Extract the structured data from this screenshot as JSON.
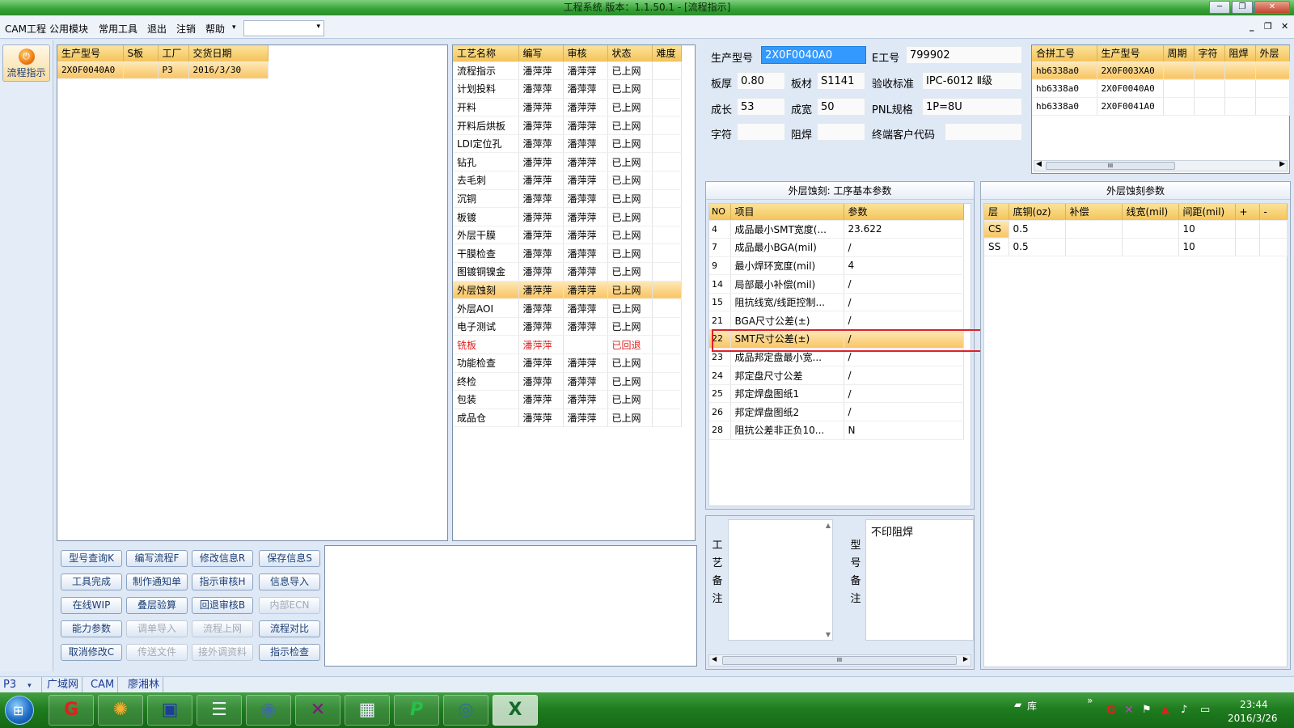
{
  "window": {
    "title": "工程系统   版本：1.1.50.1 - [流程指示]"
  },
  "menu": [
    "CAM工程",
    "公用模块",
    "常用工具",
    "退出",
    "注销",
    "帮助"
  ],
  "menu_dropdown_arrow": "▾",
  "toolbar": {
    "flow_button": "流程指示"
  },
  "orders": {
    "headers": [
      "生产型号",
      "S板",
      "工厂",
      "交货日期"
    ],
    "rows": [
      [
        "2X0F0040A0",
        "",
        "P3",
        "2016/3/30"
      ]
    ]
  },
  "process": {
    "headers": [
      "工艺名称",
      "编写",
      "审核",
      "状态",
      "难度"
    ],
    "rows": [
      [
        "流程指示",
        "潘萍萍",
        "潘萍萍",
        "已上网",
        ""
      ],
      [
        "计划投料",
        "潘萍萍",
        "潘萍萍",
        "已上网",
        ""
      ],
      [
        "开料",
        "潘萍萍",
        "潘萍萍",
        "已上网",
        ""
      ],
      [
        "开料后烘板",
        "潘萍萍",
        "潘萍萍",
        "已上网",
        ""
      ],
      [
        "LDI定位孔",
        "潘萍萍",
        "潘萍萍",
        "已上网",
        ""
      ],
      [
        "钻孔",
        "潘萍萍",
        "潘萍萍",
        "已上网",
        ""
      ],
      [
        "去毛刺",
        "潘萍萍",
        "潘萍萍",
        "已上网",
        ""
      ],
      [
        "沉铜",
        "潘萍萍",
        "潘萍萍",
        "已上网",
        ""
      ],
      [
        "板镀",
        "潘萍萍",
        "潘萍萍",
        "已上网",
        ""
      ],
      [
        "外层干膜",
        "潘萍萍",
        "潘萍萍",
        "已上网",
        ""
      ],
      [
        "干膜检查",
        "潘萍萍",
        "潘萍萍",
        "已上网",
        ""
      ],
      [
        "图镀铜镍金",
        "潘萍萍",
        "潘萍萍",
        "已上网",
        ""
      ],
      [
        "外层蚀刻",
        "潘萍萍",
        "潘萍萍",
        "已上网",
        ""
      ],
      [
        "外层AOI",
        "潘萍萍",
        "潘萍萍",
        "已上网",
        ""
      ],
      [
        "电子测试",
        "潘萍萍",
        "潘萍萍",
        "已上网",
        ""
      ],
      [
        "铣板",
        "潘萍萍",
        "",
        "已回退",
        ""
      ],
      [
        "功能检查",
        "潘萍萍",
        "潘萍萍",
        "已上网",
        ""
      ],
      [
        "终检",
        "潘萍萍",
        "潘萍萍",
        "已上网",
        ""
      ],
      [
        "包装",
        "潘萍萍",
        "潘萍萍",
        "已上网",
        ""
      ],
      [
        "成品仓",
        "潘萍萍",
        "潘萍萍",
        "已上网",
        ""
      ]
    ],
    "selected_index": 12,
    "rejected_index": 15
  },
  "info": {
    "model_label": "生产型号",
    "model": "2X0F0040A0",
    "eno_label": "E工号",
    "eno": "799902",
    "thick_label": "板厚",
    "thick": "0.80",
    "mat_label": "板材",
    "mat": "S1141",
    "std_label": "验收标准",
    "std": "IPC-6012 Ⅱ级",
    "len_label": "成长",
    "len": "53",
    "wid_label": "成宽",
    "wid": "50",
    "pnl_label": "PNL规格",
    "pnl": "1P=8U",
    "char_label": "字符",
    "mask_label": "阻焊",
    "cust_label": "终端客户代码"
  },
  "combine": {
    "headers": [
      "合拼工号",
      "生产型号",
      "周期",
      "字符",
      "阻焊",
      "外层"
    ],
    "rows": [
      [
        "hb6338a0",
        "2X0F003XA0"
      ],
      [
        "hb6338a0",
        "2X0F0040A0"
      ],
      [
        "hb6338a0",
        "2X0F0041A0"
      ]
    ],
    "scroll_thumb": "III"
  },
  "basic": {
    "title": "外层蚀刻: 工序基本参数",
    "headers": [
      "NO",
      "项目",
      "参数"
    ],
    "rows": [
      [
        "4",
        "成品最小SMT宽度(...",
        "23.622"
      ],
      [
        "7",
        "成品最小BGA(mil)",
        "/"
      ],
      [
        "9",
        "最小焊环宽度(mil)",
        "4"
      ],
      [
        "14",
        "局部最小补偿(mil)",
        "/"
      ],
      [
        "15",
        "阻抗线宽/线距控制...",
        "/"
      ],
      [
        "21",
        "BGA尺寸公差(±)",
        "/"
      ],
      [
        "22",
        "SMT尺寸公差(±)",
        "/"
      ],
      [
        "23",
        "成品邦定盘最小宽...",
        "/"
      ],
      [
        "24",
        "邦定盘尺寸公差",
        "/"
      ],
      [
        "25",
        "邦定焊盘图纸1",
        "/"
      ],
      [
        "26",
        "邦定焊盘图纸2",
        "/"
      ],
      [
        "28",
        "阻抗公差非正负10...",
        "N"
      ]
    ],
    "selected_index": 6
  },
  "etch": {
    "title": "外层蚀刻参数",
    "headers": [
      "层",
      "底铜(oz)",
      "补偿",
      "线宽(mil)",
      "间距(mil)",
      "+",
      "-"
    ],
    "rows": [
      [
        "CS",
        "0.5",
        "",
        "",
        "10",
        "",
        ""
      ],
      [
        "SS",
        "0.5",
        "",
        "",
        "10",
        "",
        ""
      ]
    ]
  },
  "notes": {
    "proc_label": "工艺备注",
    "model_label": "型号备注",
    "model_note": "不印阻焊",
    "scroll_thumb": "III"
  },
  "buttons": [
    [
      "型号查询K",
      "编写流程F",
      "修改信息R",
      "保存信息S"
    ],
    [
      "工具完成",
      "制作通知单",
      "指示审核H",
      "信息导入"
    ],
    [
      "在线WIP",
      "叠层验算",
      "回退审核B",
      "内部ECN"
    ],
    [
      "能力参数",
      "调单导入",
      "流程上网",
      "流程对比"
    ],
    [
      "取消修改C",
      "传送文件",
      "接外调资料",
      "指示检查"
    ]
  ],
  "disabled_buttons": [
    "内部ECN",
    "调单导入",
    "流程上网",
    "传送文件",
    "接外调资料"
  ],
  "status": {
    "factory": "P3",
    "items": [
      "广域网",
      "CAM",
      "廖湘林"
    ]
  },
  "taskbar": {
    "tray_label": "库",
    "time": "23:44",
    "date": "2016/3/26"
  },
  "colors": {
    "selection": "#f9c463",
    "rejected": "#e02020",
    "header": "#f4c45a",
    "highlight": "#e0202a"
  }
}
